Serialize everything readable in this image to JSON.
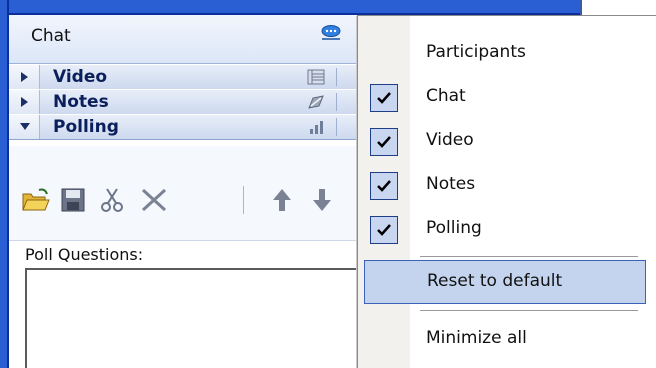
{
  "panel": {
    "chat_title": "Chat",
    "sections": [
      {
        "label": "Video",
        "icon": "video-grid-icon"
      },
      {
        "label": "Notes",
        "icon": "notes-pen-icon"
      },
      {
        "label": "Polling",
        "icon": "polling-bars-icon"
      }
    ],
    "poll_questions_label": "Poll Questions:",
    "toolbar_icons": [
      "open-folder-icon",
      "save-icon",
      "cut-icon",
      "delete-icon",
      "move-up-icon",
      "move-down-icon"
    ]
  },
  "menu": {
    "items": [
      {
        "label": "Participants",
        "checked": false,
        "accel": "P"
      },
      {
        "label": "Chat",
        "checked": true,
        "accel": "C"
      },
      {
        "label": "Video",
        "checked": true,
        "accel": "V"
      },
      {
        "label": "Notes",
        "checked": true,
        "accel": "N"
      },
      {
        "label": "Polling",
        "checked": true,
        "accel": "o"
      }
    ],
    "reset_label": "Reset to default",
    "minimize_label": "Minimize all"
  },
  "colors": {
    "border_blue": "#2a5fd4",
    "header_text": "#0b1f5c",
    "menu_highlight": "#c4d4ee"
  }
}
